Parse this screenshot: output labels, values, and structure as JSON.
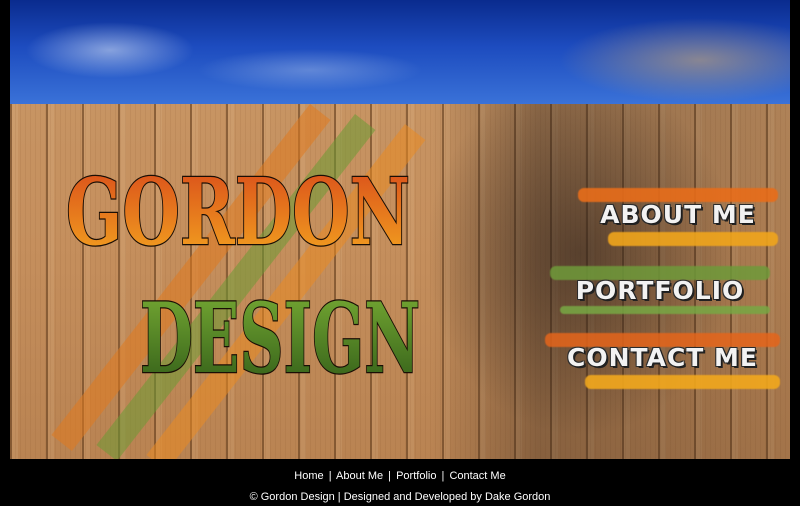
{
  "logo": {
    "line1": "GORDON",
    "line2": "DESIGN"
  },
  "nav": [
    {
      "label": "ABOUT ME",
      "splash_color": "#e86d1a",
      "splash_color2": "#f0a51c"
    },
    {
      "label": "PORTFOLIO",
      "splash_color": "#6f9a3a",
      "splash_color2": "#78a844"
    },
    {
      "label": "CONTACT ME",
      "splash_color": "#e5651b",
      "splash_color2": "#f2a81d"
    }
  ],
  "footer": {
    "links": [
      "Home",
      "About Me",
      "Portfolio",
      "Contact Me"
    ],
    "separator": "|",
    "copyright": "© Gordon Design | Designed and Developed by Dake Gordon"
  },
  "colors": {
    "logo_orange_top": "#e0561a",
    "logo_orange_bottom": "#f2a31f",
    "logo_green_top": "#6fa033",
    "logo_green_bottom": "#3d6a1e",
    "sky": "#1d4cbf",
    "fence": "#c58f5d"
  }
}
